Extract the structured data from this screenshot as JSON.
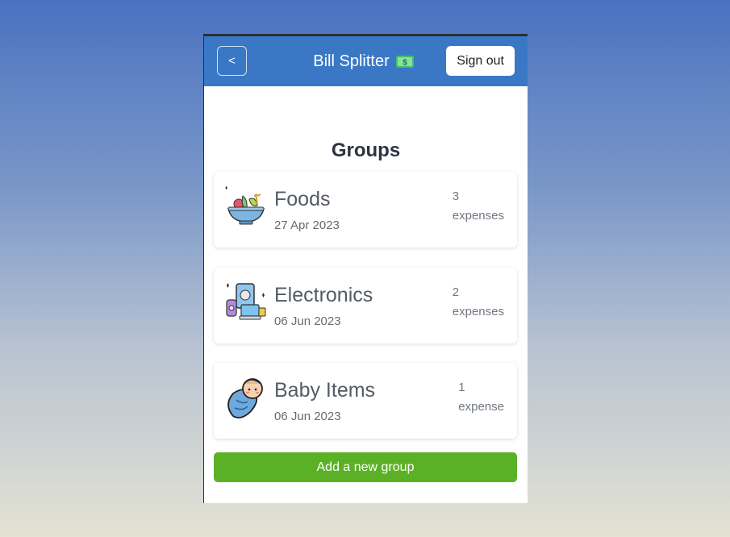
{
  "header": {
    "back_label": "<",
    "title": "Bill Splitter",
    "signout_label": "Sign out"
  },
  "page": {
    "title": "Groups"
  },
  "groups": [
    {
      "name": "Foods",
      "date": "27 Apr 2023",
      "count": "3",
      "unit": "expenses",
      "icon": "salad-bowl-icon"
    },
    {
      "name": "Electronics",
      "date": "06 Jun 2023",
      "count": "2",
      "unit": "expenses",
      "icon": "devices-icon"
    },
    {
      "name": "Baby Items",
      "date": "06 Jun 2023",
      "count": "1",
      "unit": "expense",
      "icon": "baby-icon"
    }
  ],
  "actions": {
    "add_group_label": "Add a new group"
  },
  "colors": {
    "navbar": "#3a78c6",
    "add_button": "#5bb126"
  }
}
